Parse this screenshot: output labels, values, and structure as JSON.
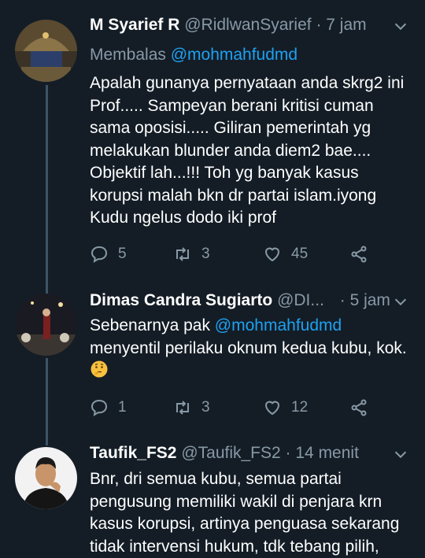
{
  "tweets": [
    {
      "name": "M Syarief R",
      "handle": "@RidlwanSyarief",
      "time": "· 7 jam",
      "reply_prefix": "Membalas ",
      "reply_mention": "@mohmahfudmd",
      "body": "Apalah gunanya pernyataan anda skrg2 ini Prof.....  Sampeyan berani kritisi cuman sama oposisi..... Giliran   pemerintah yg melakukan blunder anda diem2 bae.... Objektif lah...!!! Toh yg banyak kasus korupsi malah bkn dr partai islam.iyong Kudu ngelus dodo iki prof",
      "replies": "5",
      "retweets": "3",
      "likes": "45"
    },
    {
      "name": "Dimas Candra Sugiarto",
      "handle": "@DI...",
      "time": "· 5 jam",
      "body_pre": "Sebenarnya pak ",
      "body_mention": "@mohmahfudmd",
      "body_post": "menyentil perilaku oknum kedua kubu, kok.",
      "emoji": "thinking-face",
      "replies": "1",
      "retweets": "3",
      "likes": "12"
    },
    {
      "name": "Taufik_FS2",
      "handle": "@Taufik_FS2",
      "time": "· 14 menit",
      "body": "Bnr, dri semua kubu, semua partai pengusung memiliki wakil di penjara krn kasus korupsi, artinya penguasa sekarang tidak intervensi hukum, tdk tebang pilih,"
    }
  ],
  "colors": {
    "background": "#141d26",
    "muted": "#8899a6",
    "link": "#1da1f2",
    "thread_line": "#3d5466"
  }
}
